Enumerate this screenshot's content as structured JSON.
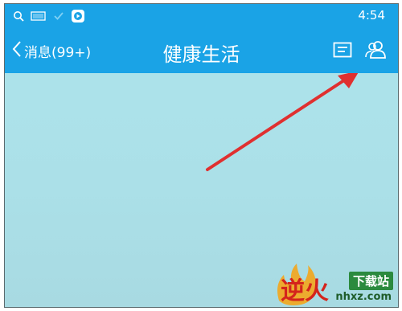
{
  "status_bar": {
    "time": "4:54",
    "icons": [
      "search-icon",
      "battery-100-icon",
      "check-icon",
      "app-notification-icon"
    ]
  },
  "nav": {
    "back_label": "消息(99+)",
    "title": "健康生活",
    "right_buttons": [
      "card-list-icon",
      "profile-people-icon"
    ]
  },
  "annotation": {
    "arrow_color": "#e03030",
    "points_to": "profile-people-icon"
  },
  "watermark": {
    "brand_chars": "逆火",
    "badge": "下载站",
    "domain": "nhxz.com"
  },
  "colors": {
    "header": "#1aa3e6",
    "content_bg": "#ade4ec"
  }
}
